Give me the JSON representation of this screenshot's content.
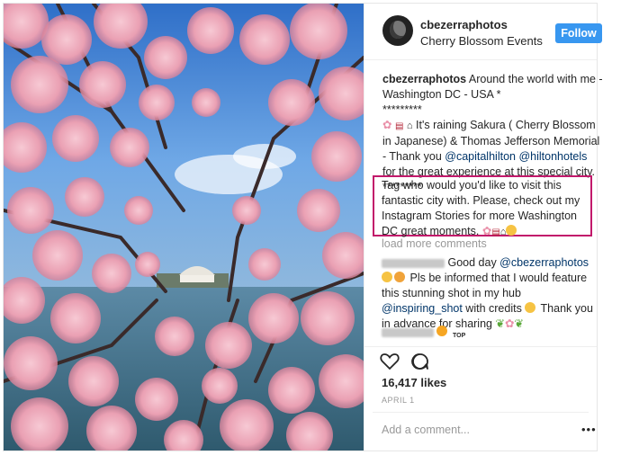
{
  "post": {
    "username": "cbezerraphotos",
    "location": "Cherry Blossom Events",
    "follow_label": "Follow"
  },
  "caption": {
    "username": "cbezerraphotos",
    "line1": "Around the world with me - Washington DC - USA *",
    "stars": "*********",
    "line2a": "It's raining Sakura ( Cherry Blossom in Japanese) & Thomas Jefferson Memorial - Thank you ",
    "mention1": "@capitalhilton",
    "mention2": "@hiltonhotels",
    "line2b": " for the great experience at this special city. *********",
    "highlight": "Tag who would you'd like to visit this fantastic city with. Please, check out my Instagram Stories for more Washington DC great moments."
  },
  "load_more": "load more comments",
  "comment2": {
    "text1": "Good day ",
    "mention": "@cbezerraphotos",
    "text2": "Pls be informed that I would feature this stunning shot in my hub ",
    "hub": "@inspiring_shot",
    "text3": " with credits ",
    "text4": " Thank you in advance for sharing"
  },
  "comment3": {
    "badge": "TOP"
  },
  "likes": "16,417 likes",
  "date": "APRIL 1",
  "add_comment": "Add a comment...",
  "more_label": "•••",
  "icons": [
    "heart-icon",
    "comment-icon",
    "more-options-icon"
  ],
  "colors": {
    "follow": "#3897f0",
    "highlight": "#c2196b",
    "link": "#003569"
  }
}
